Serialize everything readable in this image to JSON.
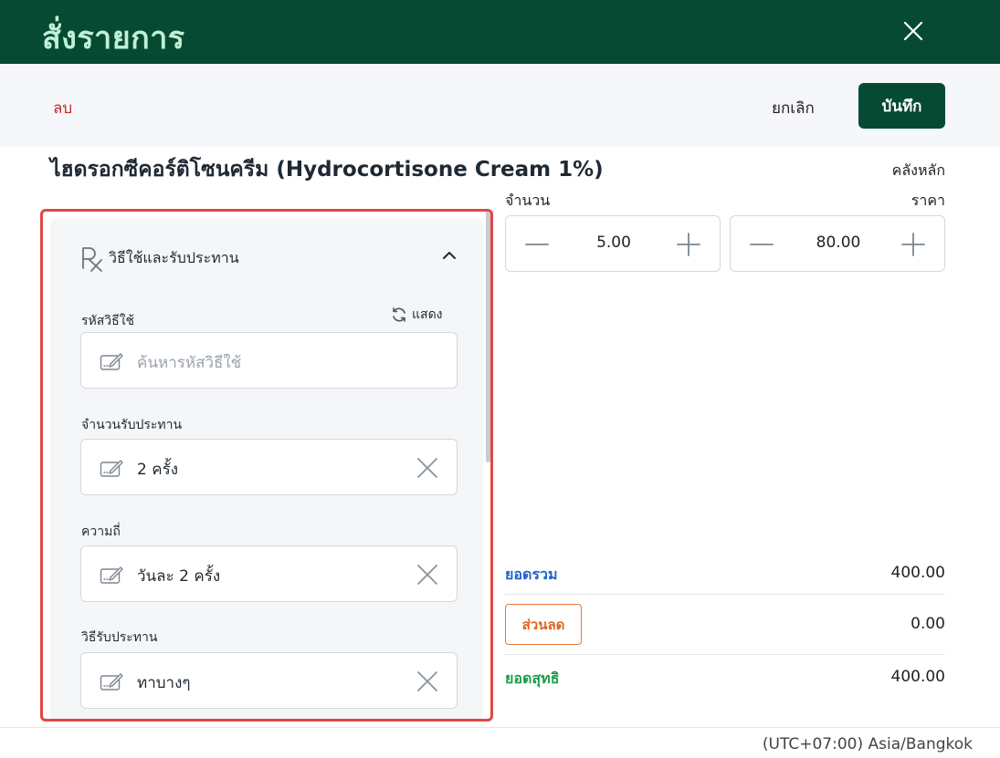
{
  "header": {
    "title": "สั่งรายการ"
  },
  "toolbar": {
    "delete_label": "ลบ",
    "cancel_label": "ยกเลิก",
    "save_label": "บันทึก"
  },
  "product": {
    "name": "ไฮดรอกซีคอร์ติโซนครีม (Hydrocortisone Cream 1%)",
    "warehouse": "คลังหลัก"
  },
  "usage": {
    "section_title": "วิธีใช้และรับประทาน",
    "code_label": "รหัสวิธีใช้",
    "show_label": "แสดง",
    "code_placeholder": "ค้นหารหัสวิธีใช้",
    "amount_label": "จำนวนรับประทาน",
    "amount_value": "2 ครั้ง",
    "frequency_label": "ความถี่",
    "frequency_value": "วันละ 2 ครั้ง",
    "method_label": "วิธีรับประทาน",
    "method_value": "ทาบางๆ"
  },
  "order": {
    "quantity_label": "จำนวน",
    "quantity_value": "5.00",
    "price_label": "ราคา",
    "price_value": "80.00"
  },
  "summary": {
    "total_label": "ยอดรวม",
    "total_value": "400.00",
    "discount_label": "ส่วนลด",
    "discount_value": "0.00",
    "net_label": "ยอดสุทธิ",
    "net_value": "400.00"
  },
  "footer": {
    "timezone": "(UTC+07:00) Asia/Bangkok"
  },
  "colors": {
    "brand": "#074a34",
    "header_text": "#bff0d6",
    "delete": "#c62828",
    "total": "#1e63c9",
    "discount": "#e0631f",
    "net": "#1e9c4a",
    "highlight": "#e04848"
  }
}
